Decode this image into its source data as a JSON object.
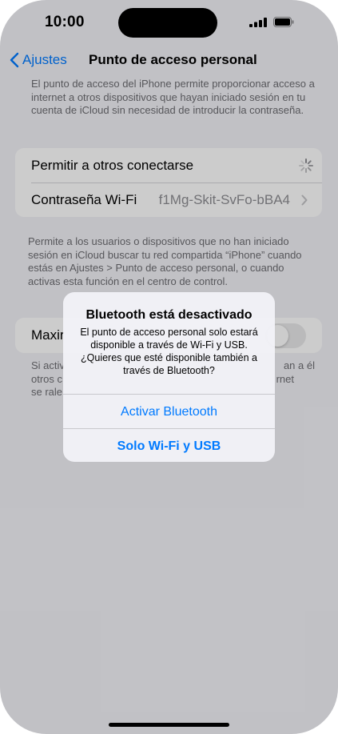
{
  "status_bar": {
    "time": "10:00"
  },
  "nav": {
    "back_label": "Ajustes",
    "title": "Punto de acceso personal"
  },
  "intro_text": "El punto de acceso del iPhone permite proporcionar acceso a internet a otros dispositivos que hayan iniciado sesión en tu cuenta de iCloud sin necesidad de introducir la contraseña.",
  "settings": {
    "allow_others_label": "Permitir a otros conectarse",
    "wifi_password_label": "Contraseña Wi-Fi",
    "wifi_password_value": "f1Mg-Skit-SvFo-bBA4"
  },
  "footer_text": "Permite a los usuarios o dispositivos que no han iniciado sesión en iCloud buscar tu red compartida “iPhone” cuando estás en Ajustes > Punto de acceso personal, o cuando activas esta función en el centro de control.",
  "maximize": {
    "label": "Maxir",
    "footer_line1_left": "Si activ",
    "footer_line1_right": "an a él",
    "footer_line2_left": "otros c",
    "footer_line2_right": "rnet",
    "footer_line3_left": "se rale"
  },
  "alert": {
    "title": "Bluetooth está desactivado",
    "message": "El punto de acceso personal solo estará disponible a través de Wi-Fi y USB. ¿Quieres que esté disponible también a través de Bluetooth?",
    "button_enable_bluetooth": "Activar Bluetooth",
    "button_wifi_usb_only": "Solo Wi-Fi y USB"
  },
  "colors": {
    "accent": "#007aff",
    "background": "#f2f2f7"
  },
  "icons": [
    "signal-icon",
    "battery-icon",
    "chevron-left-icon",
    "chevron-right-icon",
    "spinner-icon"
  ]
}
